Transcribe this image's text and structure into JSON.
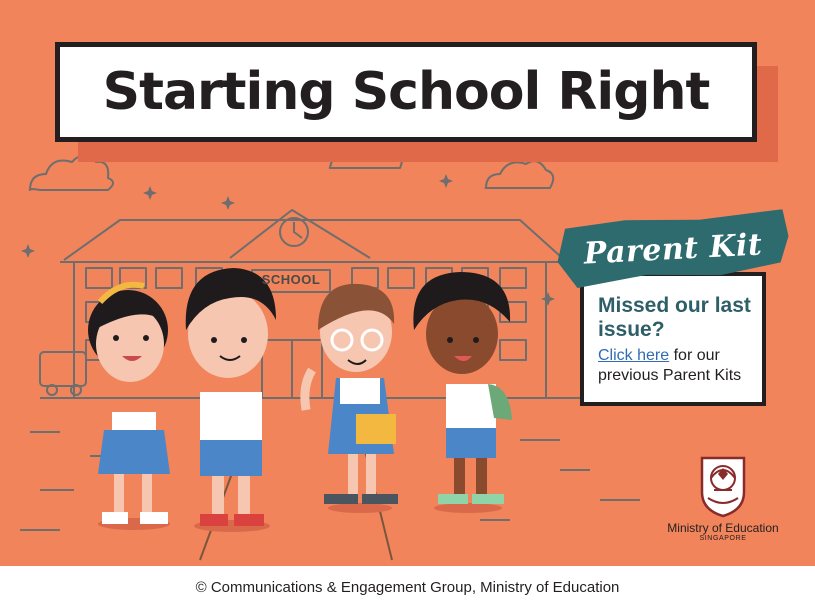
{
  "poster": {
    "title": "Starting School Right",
    "school_sign": "SCHOOL",
    "kit_label": "Parent Kit",
    "kit_heading": "Missed our last issue?",
    "kit_link": "Click here",
    "kit_text": "for our previous Parent Kits",
    "ministry_name": "Ministry of Education",
    "ministry_country": "SINGAPORE"
  },
  "footer": {
    "copyright": "© Communications & Engagement Group, Ministry of Education"
  },
  "colors": {
    "background": "#F1845A",
    "title_text": "#231F20",
    "teal": "#2D6B6E",
    "link": "#2F6CB5",
    "uniform_blue": "#4A86C8"
  },
  "icons": [
    "clock-icon",
    "cloud-icon",
    "sparkle-icon",
    "ministry-crest-icon"
  ]
}
